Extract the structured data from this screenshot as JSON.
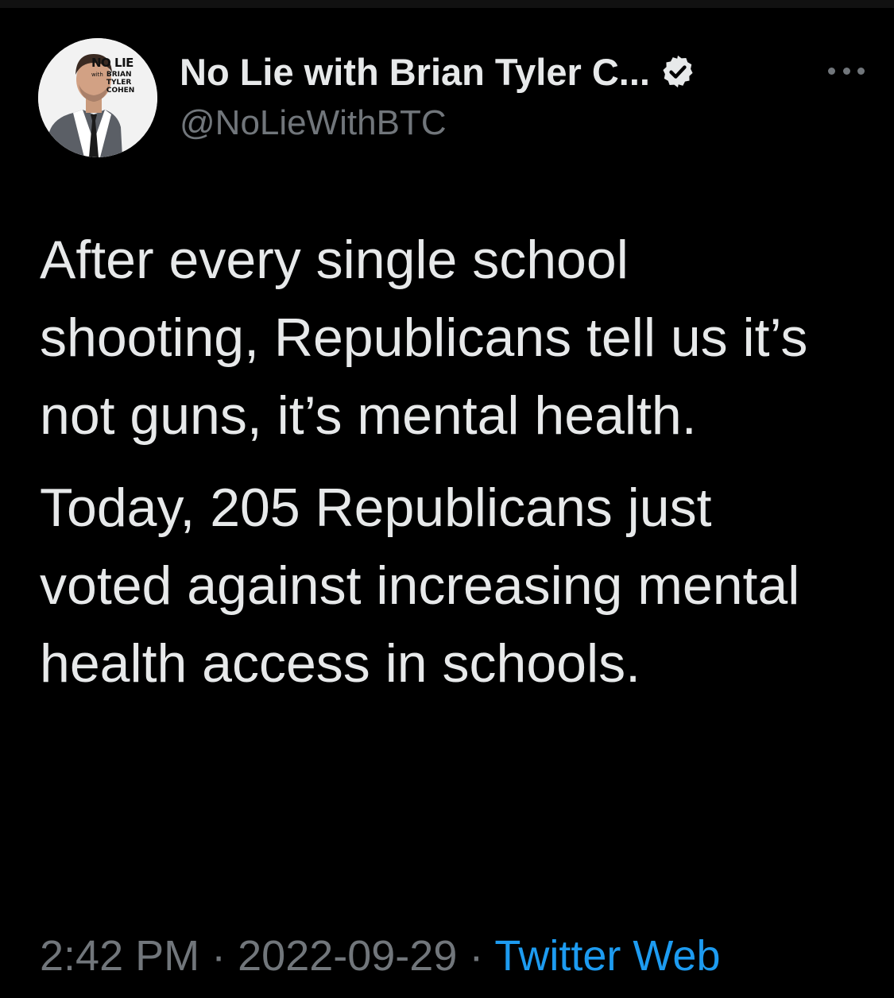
{
  "account": {
    "display_name": "No Lie with Brian Tyler C...",
    "handle": "@NoLieWithBTC",
    "verified": true,
    "avatar_badge": [
      "NO LIE",
      "with",
      "BRIAN",
      "TYLER",
      "COHEN"
    ]
  },
  "icons": {
    "verified": "verified-badge-icon",
    "more": "more-options-icon"
  },
  "tweet": {
    "paragraphs": [
      "After every single school shooting, Republicans tell us it’s not guns, it’s mental health.",
      "Today, 205 Republicans just voted against increasing mental health access in schools."
    ]
  },
  "meta": {
    "time": "2:42 PM",
    "separator": "·",
    "date": "2022-09-29",
    "source": "Twitter Web"
  },
  "colors": {
    "background": "#000000",
    "primary_text": "#e7e9ea",
    "secondary_text": "#71767b",
    "link": "#1d9bf0"
  }
}
